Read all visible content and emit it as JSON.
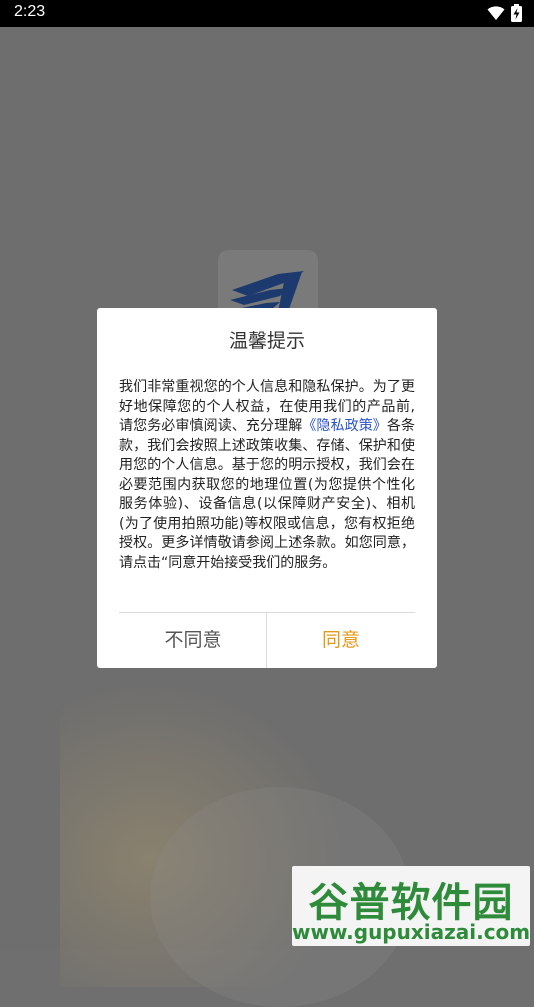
{
  "status_bar": {
    "time": "2:23",
    "icons": [
      "wifi-icon",
      "battery-charging-icon"
    ]
  },
  "dialog": {
    "title": "温馨提示",
    "body_before_link": "我们非常重视您的个人信息和隐私保护。为了更好地保障您的个人权益，在使用我们的产品前,请您务必审慎阅读、充分理解",
    "privacy_link": "《隐私政策》",
    "body_after_link": "各条款，我们会按照上述政策收集、存储、保护和使用您的个人信息。基于您的明示授权，我们会在必要范围内获取您的地理位置(为您提供个性化服务体验)、设备信息(以保障财产安全)、相机(为了使用拍照功能)等权限或信息，您有权拒绝授权。更多详情敬请参阅上述条款。如您同意，请点击“同意开始接受我们的服务。",
    "disagree_label": "不同意",
    "agree_label": "同意"
  },
  "watermark": {
    "title": "谷普软件园",
    "url": "www.gupuxiazai.com"
  },
  "colors": {
    "agree": "#e39a1a",
    "link": "#2b52c9",
    "watermark": "#2e8b3a"
  }
}
